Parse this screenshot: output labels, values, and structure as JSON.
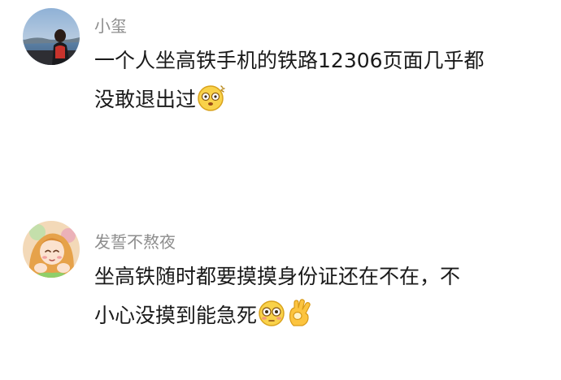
{
  "comments": [
    {
      "username": "小玺",
      "line1": "一个人坐高铁手机的铁路12306页面几乎都",
      "line2": "没敢退出过",
      "emojis": [
        "dizzy-face-emoji"
      ]
    },
    {
      "username": "发誓不熬夜",
      "line1": "坐高铁随时都要摸摸身份证还在不在，不",
      "line2": "小心没摸到能急死",
      "emojis": [
        "flushed-face-emoji",
        "ok-hand-emoji"
      ]
    }
  ]
}
